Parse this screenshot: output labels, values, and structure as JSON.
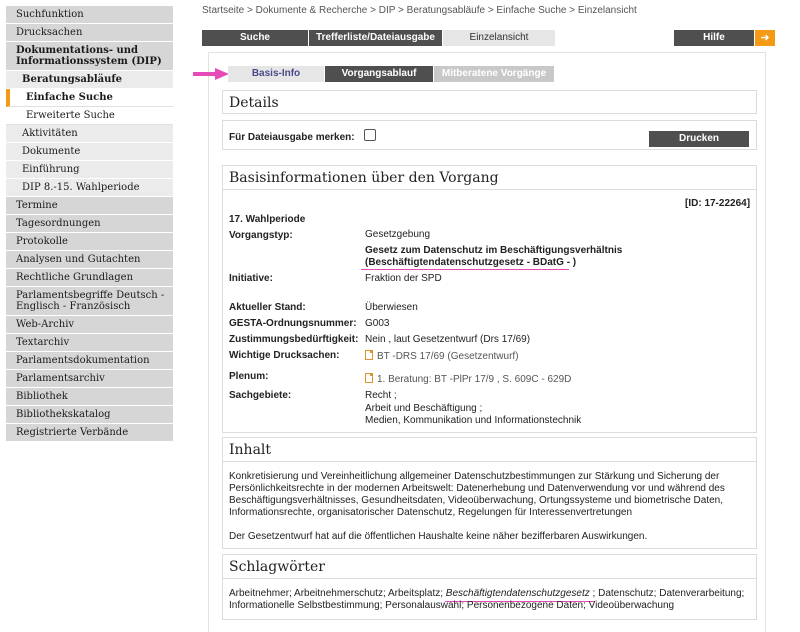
{
  "sidebar": {
    "items": [
      {
        "label": "Suchfunktion"
      },
      {
        "label": "Drucksachen"
      },
      {
        "label": "Dokumentations- und Informationssystem (DIP)"
      },
      {
        "label": "Beratungsabläufe"
      },
      {
        "label": "Einfache Suche"
      },
      {
        "label": "Erweiterte Suche"
      },
      {
        "label": "Aktivitäten"
      },
      {
        "label": "Dokumente"
      },
      {
        "label": "Einführung"
      },
      {
        "label": "DIP 8.-15. Wahlperiode"
      },
      {
        "label": "Termine"
      },
      {
        "label": "Tagesordnungen"
      },
      {
        "label": "Protokolle"
      },
      {
        "label": "Analysen und Gutachten"
      },
      {
        "label": "Rechtliche Grundlagen"
      },
      {
        "label": "Parlamentsbegriffe Deutsch - Englisch - Französisch"
      },
      {
        "label": "Web-Archiv"
      },
      {
        "label": "Textarchiv"
      },
      {
        "label": "Parlamentsdokumentation"
      },
      {
        "label": "Parlamentsarchiv"
      },
      {
        "label": "Bibliothek"
      },
      {
        "label": "Bibliothekskatalog"
      },
      {
        "label": "Registrierte Verbände"
      }
    ]
  },
  "breadcrumb": "Startseite > Dokumente & Recherche > DIP > Beratungsabläufe > Einfache Suche > Einzelansicht",
  "topnav": {
    "tabs": [
      {
        "label": "Suche"
      },
      {
        "label": "Trefferliste/Dateiausgabe"
      },
      {
        "label": "Einzelansicht"
      }
    ],
    "help": "Hilfe",
    "help_arrow": "➜"
  },
  "subtabs": [
    {
      "label": "Basis-Info"
    },
    {
      "label": "Vorgangsablauf"
    },
    {
      "label": "Mitberatene Vorgänge"
    }
  ],
  "details": {
    "title": "Details",
    "merk_label": "Für Dateiausgabe merken:",
    "print_label": "Drucken"
  },
  "basis": {
    "title": "Basisinformationen über den Vorgang",
    "id": "[ID: 17-22264]",
    "wahlperiode": "17. Wahlperiode",
    "vorgangstyp_label": "Vorgangstyp:",
    "vorgangstyp": "Gesetzgebung",
    "gesetz_line1": "Gesetz zum Datenschutz im Beschäftigungsverhältnis",
    "gesetz_line2": "(Beschäftigtendatenschutzgesetz - BDatG - )",
    "initiative_label": "Initiative:",
    "initiative": "Fraktion der SPD",
    "stand_label": "Aktueller Stand:",
    "stand": "Überwiesen",
    "gesta_label": "GESTA-Ordnungsnummer:",
    "gesta": "G003",
    "zustimmung_label": "Zustimmungsbedürftigkeit:",
    "zustimmung": "Nein , laut Gesetzentwurf (Drs 17/69)",
    "drucksachen_label": "Wichtige Drucksachen:",
    "drucksachen": "BT -DRS 17/69 (Gesetzentwurf)",
    "plenum_label": "Plenum:",
    "plenum": "1. Beratung:  BT -PlPr  17/9 , S. 609C - 629D",
    "sachgebiete_label": "Sachgebiete:",
    "sachgebiete1": "Recht ;",
    "sachgebiete2": "Arbeit und Beschäftigung ;",
    "sachgebiete3": "Medien, Kommunikation und Informationstechnik"
  },
  "inhalt": {
    "title": "Inhalt",
    "p1_l1": "Konkretisierung und Vereinheitlichung allgemeiner Datenschutzbestimmungen zur Stärkung und Sicherung der",
    "p1_l2": "Persönlichkeitsrechte in der modernen Arbeitswelt: Datenerhebung und Datenverwendung vor und während des",
    "p1_l3": "Beschäftigungsverhältnisses, Gesundheitsdaten, Videoüberwachung, Ortungssysteme und biometrische Daten,",
    "p1_l4": "Informationsrechte, organisatorischer Datenschutz, Regelungen für Interessenvertretungen",
    "p2": "Der Gesetzentwurf hat auf die öffentlichen Haushalte keine näher bezifferbaren Auswirkungen."
  },
  "schlag": {
    "title": "Schlagwörter",
    "l1_a": "Arbeitnehmer; Arbeitnehmerschutz; Arbeitsplatz; ",
    "l1_b": "Beschäftigtendatenschutzgesetz",
    "l1_c": " ; Datenschutz; Datenverarbeitung;",
    "l2": "Informationelle Selbstbestimmung; Personalauswahl; Personenbezogene Daten; Videoüberwachung"
  },
  "colors": {
    "accent": "#f59a14",
    "dark_tab": "#4f4f4f",
    "highlight": "#e64ab8"
  }
}
